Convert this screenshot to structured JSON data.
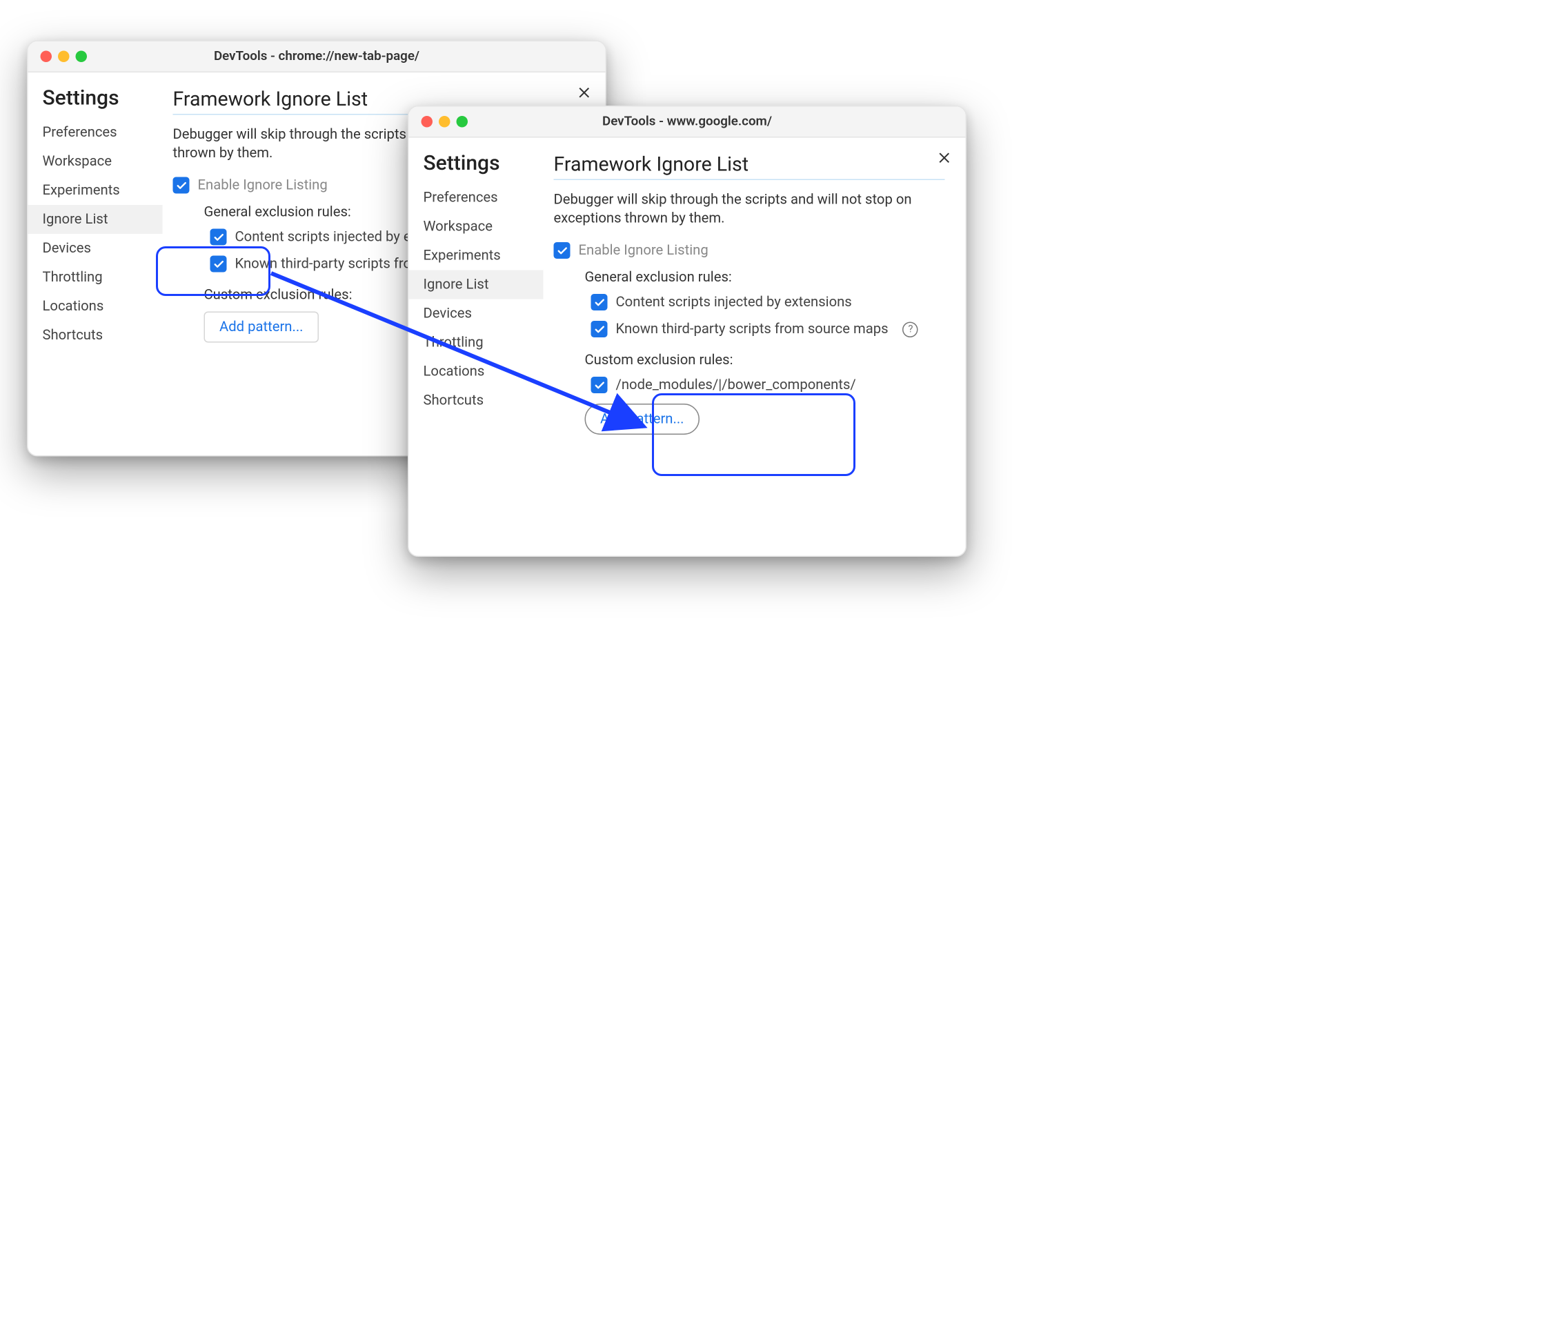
{
  "windows": [
    {
      "title": "DevTools - chrome://new-tab-page/",
      "settings_heading": "Settings",
      "nav": [
        "Preferences",
        "Workspace",
        "Experiments",
        "Ignore List",
        "Devices",
        "Throttling",
        "Locations",
        "Shortcuts"
      ],
      "active_nav": "Ignore List",
      "pane_title": "Framework Ignore List",
      "pane_desc_truncated": "Debugger will skip through the scripts",
      "pane_desc_line2": "thrown by them.",
      "enable_label": "Enable Ignore Listing",
      "general_heading": "General exclusion rules:",
      "general_rules": [
        {
          "label_truncated": "Content scripts injected by e",
          "checked": true
        },
        {
          "label_truncated": "Known third-party scripts fro",
          "checked": true
        }
      ],
      "custom_heading": "Custom exclusion rules:",
      "custom_rules": [],
      "add_pattern_label": "Add pattern..."
    },
    {
      "title": "DevTools - www.google.com/",
      "settings_heading": "Settings",
      "nav": [
        "Preferences",
        "Workspace",
        "Experiments",
        "Ignore List",
        "Devices",
        "Throttling",
        "Locations",
        "Shortcuts"
      ],
      "active_nav": "Ignore List",
      "pane_title": "Framework Ignore List",
      "pane_desc": "Debugger will skip through the scripts and will not stop on exceptions thrown by them.",
      "enable_label": "Enable Ignore Listing",
      "general_heading": "General exclusion rules:",
      "general_rules": [
        {
          "label": "Content scripts injected by extensions",
          "checked": true
        },
        {
          "label": "Known third-party scripts from source maps",
          "checked": true,
          "help": true
        }
      ],
      "custom_heading": "Custom exclusion rules:",
      "custom_rules": [
        {
          "pattern": "/node_modules/|/bower_components/",
          "checked": true
        }
      ],
      "add_pattern_label": "Add pattern..."
    }
  ],
  "annotation": {
    "color": "#1a3fff"
  }
}
